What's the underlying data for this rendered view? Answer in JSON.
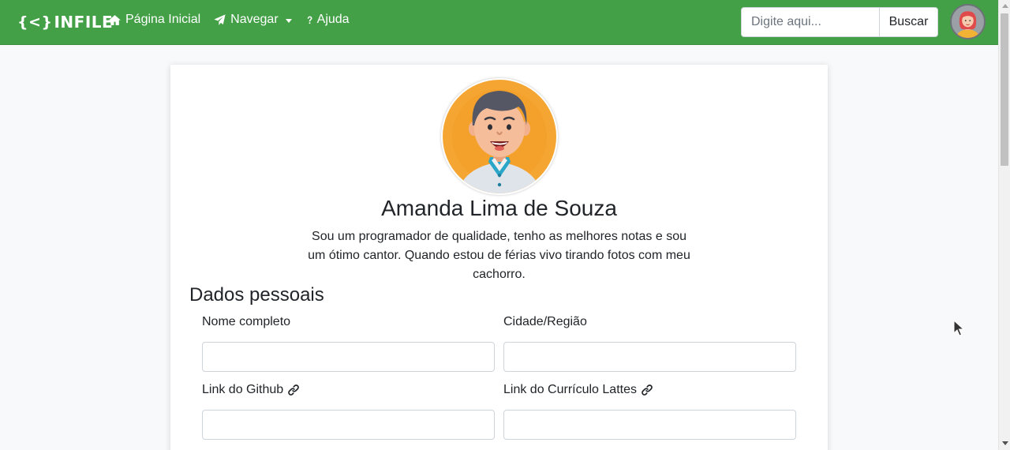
{
  "navbar": {
    "brand": "INFILE",
    "brand_glyph": "{<}",
    "links": [
      {
        "label": "Página Inicial",
        "icon": "home-icon"
      },
      {
        "label": "Navegar",
        "icon": "paper-plane-icon",
        "dropdown": true
      },
      {
        "label": "Ajuda",
        "icon": "question-icon"
      }
    ],
    "search": {
      "placeholder": "Digite aqui...",
      "button_label": "Buscar"
    },
    "accent_color": "#43a047"
  },
  "profile": {
    "name": "Amanda Lima de Souza",
    "bio": "Sou um programador de qualidade, tenho as melhores notas e sou um ótimo cantor. Quando estou de férias vivo tirando fotos com meu cachorro."
  },
  "personal_data": {
    "title": "Dados pessoais",
    "fields": [
      {
        "label": "Nome completo",
        "value": ""
      },
      {
        "label": "Cidade/Região",
        "value": ""
      },
      {
        "label": "Link do Github",
        "value": "",
        "icon": "link-icon"
      },
      {
        "label": "Link do Currículo Lattes",
        "value": "",
        "icon": "link-icon"
      }
    ]
  }
}
